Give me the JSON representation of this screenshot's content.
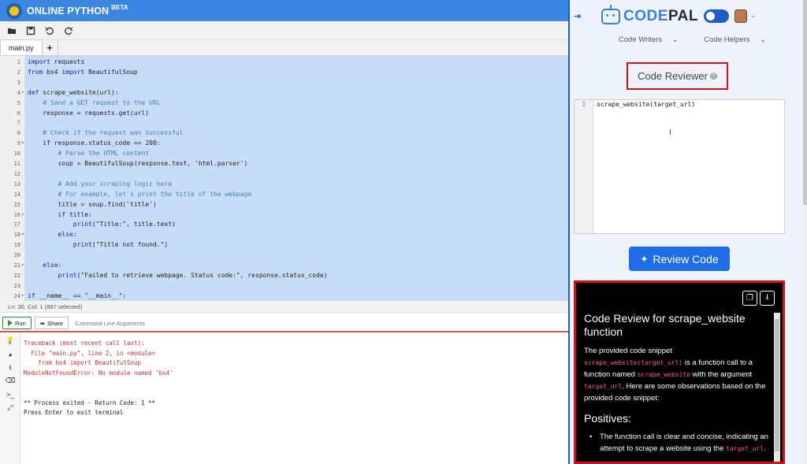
{
  "left": {
    "brand": "ONLINE PYTHON",
    "brand_badge": "BETA",
    "toolbar": {
      "icons": [
        "folder-icon",
        "save-icon",
        "undo-icon",
        "redo-icon"
      ]
    },
    "tab": {
      "label": "main.py",
      "add": "+"
    },
    "code_lines": [
      {
        "n": "1",
        "text": "import requests"
      },
      {
        "n": "2",
        "text": "from bs4 import BeautifulSoup"
      },
      {
        "n": "3",
        "text": ""
      },
      {
        "n": "4",
        "text": "def scrape_website(url):",
        "fold": true
      },
      {
        "n": "5",
        "text": "    # Send a GET request to the URL"
      },
      {
        "n": "6",
        "text": "    response = requests.get(url)"
      },
      {
        "n": "7",
        "text": ""
      },
      {
        "n": "8",
        "text": "    # Check if the request was successful"
      },
      {
        "n": "9",
        "text": "    if response.status_code == 200:",
        "fold": true
      },
      {
        "n": "10",
        "text": "        # Parse the HTML content"
      },
      {
        "n": "11",
        "text": "        soup = BeautifulSoup(response.text, 'html.parser')"
      },
      {
        "n": "12",
        "text": ""
      },
      {
        "n": "13",
        "text": "        # Add your scraping logic here"
      },
      {
        "n": "14",
        "text": "        # For example, let's print the title of the webpage"
      },
      {
        "n": "15",
        "text": "        title = soup.find('title')"
      },
      {
        "n": "16",
        "text": "        if title:",
        "fold": true
      },
      {
        "n": "17",
        "text": "            print(\"Title:\", title.text)"
      },
      {
        "n": "18",
        "text": "        else:",
        "fold": true
      },
      {
        "n": "19",
        "text": "            print(\"Title not found.\")"
      },
      {
        "n": "20",
        "text": ""
      },
      {
        "n": "21",
        "text": "    else:",
        "fold": true
      },
      {
        "n": "22",
        "text": "        print(\"Failed to retrieve webpage. Status code:\", response.status_code)"
      },
      {
        "n": "23",
        "text": ""
      },
      {
        "n": "24",
        "text": "if __name__ == \"__main__\":",
        "fold": true
      }
    ],
    "status": "Ln: 30,  Col: 1 (887 selected)",
    "run_label": "Run",
    "share_label": "Share",
    "cla_label": "Command Line Arguments",
    "terminal_icons": [
      "lightbulb-icon",
      "palette-icon",
      "download-icon",
      "eraser-icon",
      "terminal-icon",
      "expand-icon"
    ],
    "terminal_lines": [
      {
        "cls": "err",
        "text": "Traceback (most recent call last):"
      },
      {
        "cls": "err",
        "text": "  File \"main.py\", line 2, in <module>"
      },
      {
        "cls": "err",
        "text": "    from bs4 import BeautifulSoup"
      },
      {
        "cls": "err",
        "text": "ModuleNotFoundError: No module named 'bs4'"
      },
      {
        "cls": "out",
        "text": ""
      },
      {
        "cls": "out",
        "text": ""
      },
      {
        "cls": "out",
        "text": "** Process exited - Return Code: 1 **"
      },
      {
        "cls": "out",
        "text": "Press Enter to exit terminal"
      }
    ]
  },
  "right": {
    "logo_prefix": "CODE",
    "logo_suffix": "PAL",
    "nav": [
      "Code Writers",
      "Code Helpers"
    ],
    "tool_title": "Code Reviewer",
    "editor_line_number": "1",
    "editor_code": "scrape_website(target_url)",
    "review_button": "Review Code",
    "output": {
      "title": "Code Review for scrape_website function",
      "p1_a": "The provided code snippet ",
      "p1_code1": "scrape_website(target_url)",
      "p1_b": " is a function call to a function named ",
      "p1_code2": "scrape_website",
      "p1_c": " with the argument ",
      "p1_code3": "target_url",
      "p1_d": ". Here are some observations based on the provided code snippet:",
      "h2": "Positives:",
      "li1_a": "The function call is clear and concise, indicating an attempt to scrape a website using the ",
      "li1_code": "target_url",
      "li1_b": "."
    }
  },
  "colors": {
    "accent_blue": "#1e6ce6",
    "highlight_red": "#d0121c",
    "selection": "#c7ddf7"
  }
}
